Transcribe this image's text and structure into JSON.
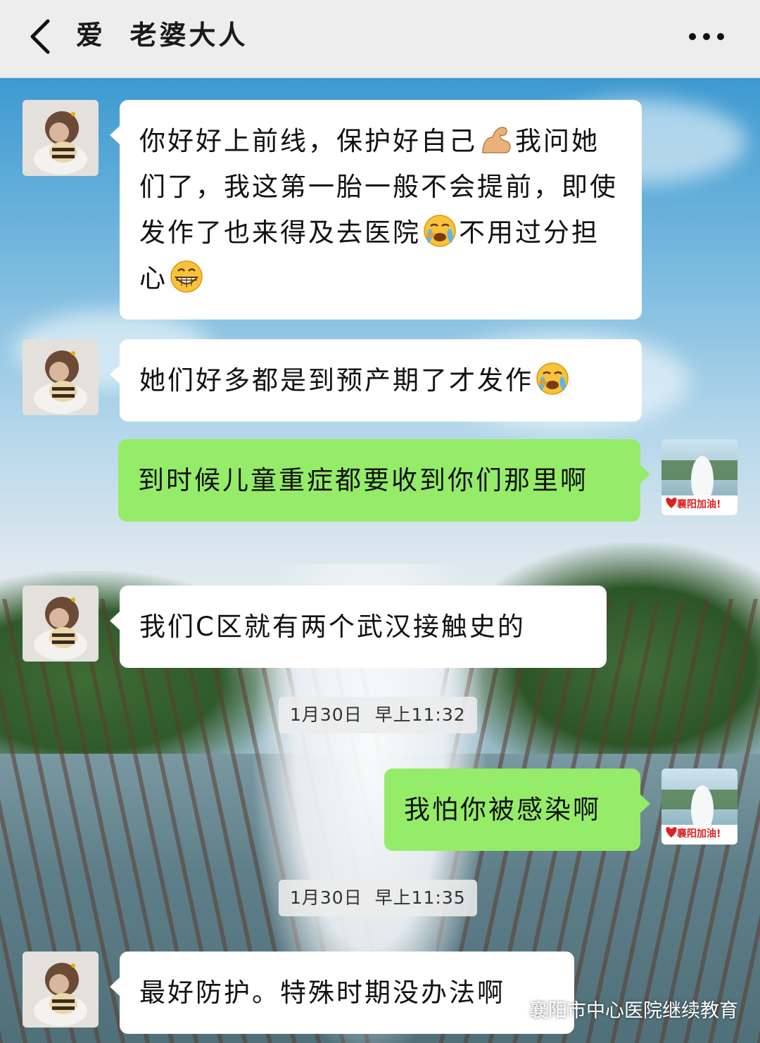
{
  "header": {
    "title": "爱  老婆大人",
    "back_icon": "chevron-left-icon",
    "more_icon": "more-dots-icon"
  },
  "messages": [
    {
      "direction": "incoming",
      "segments": [
        {
          "text": "你好好上前线，保护好自己"
        },
        {
          "emoji": "flexed-biceps"
        },
        {
          "text": "我问她们了，我这第一胎一般不会提前，即使发作了也来得及去医院"
        },
        {
          "emoji": "face-crying"
        },
        {
          "text": "不用过分担心"
        },
        {
          "emoji": "face-grinning"
        }
      ]
    },
    {
      "direction": "incoming",
      "segments": [
        {
          "text": "她们好多都是到预产期了才发作"
        },
        {
          "emoji": "face-crying"
        }
      ]
    },
    {
      "direction": "outgoing",
      "text": "到时候儿童重症都要收到你们那里啊",
      "avatar_badge": "襄阳加油!"
    },
    {
      "direction": "incoming",
      "text": "我们C区就有两个武汉接触史的"
    },
    {
      "timestamp": "1月30日  早上11:32"
    },
    {
      "direction": "outgoing",
      "text": "我怕你被感染啊",
      "avatar_badge": "襄阳加油!"
    },
    {
      "timestamp": "1月30日  早上11:35"
    },
    {
      "direction": "incoming",
      "text": "最好防护。特殊时期没办法啊"
    }
  ],
  "watermark": {
    "text": "襄阳市中心医院继续教育",
    "icon": "wechat-channel-icon"
  },
  "colors": {
    "header_bg": "#ededed",
    "incoming_bubble": "#ffffff",
    "outgoing_bubble": "#95ec69",
    "text": "#111111"
  }
}
